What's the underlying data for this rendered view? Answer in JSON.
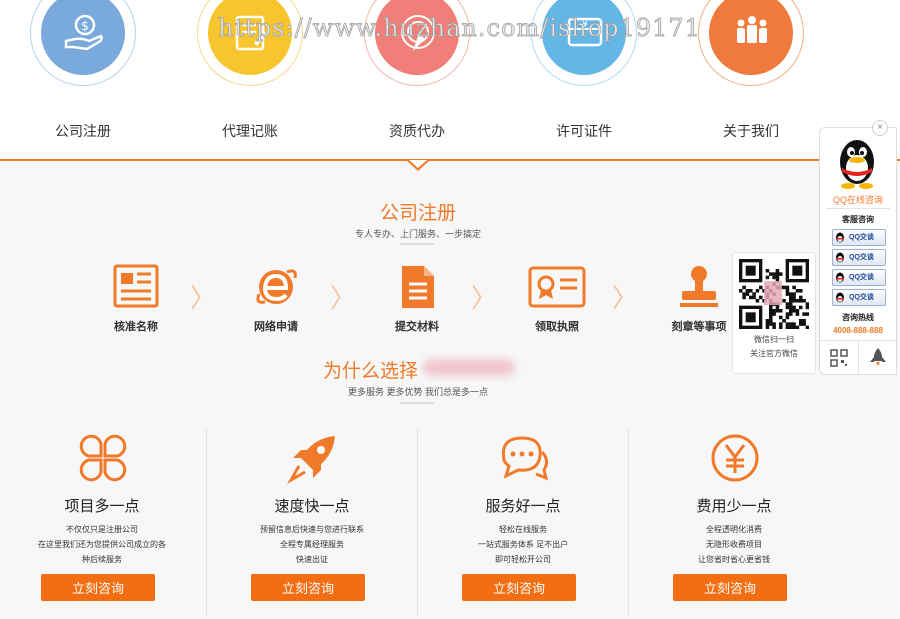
{
  "watermark": "https://www.huzhan.com/ishop19171",
  "nav": {
    "items": [
      {
        "label": "公司注册",
        "icon": "money-hand-icon",
        "color": "#7aa9dc"
      },
      {
        "label": "代理记账",
        "icon": "document-edit-icon",
        "color": "#f7c62e"
      },
      {
        "label": "资质代办",
        "icon": "target-arrow-icon",
        "color": "#ef7f78"
      },
      {
        "label": "许可证件",
        "icon": "certificate-yen-icon",
        "color": "#63b6e6"
      },
      {
        "label": "关于我们",
        "icon": "team-people-icon",
        "color": "#f07a3c"
      }
    ]
  },
  "registration": {
    "title": "公司注册",
    "subtitle": "专人专办、上门服务、一步搞定",
    "steps": [
      "核准名称",
      "网络申请",
      "提交材料",
      "领取执照",
      "刻章等事项"
    ]
  },
  "why": {
    "title": "为什么选择",
    "subtitle": "更多服务 更多优势 我们总是多一点"
  },
  "features": [
    {
      "title": "项目多一点",
      "icon": "clover-icon",
      "lines": [
        "不仅仅只是注册公司",
        "在这里我们还为您提供公司成立的各",
        "种后续服务"
      ],
      "button": "立刻咨询"
    },
    {
      "title": "速度快一点",
      "icon": "rocket-icon",
      "lines": [
        "预留信息后快速与您进行联系",
        "全程专属经理服务",
        "快速出证"
      ],
      "button": "立刻咨询"
    },
    {
      "title": "服务好一点",
      "icon": "chat-bubbles-icon",
      "lines": [
        "轻松在线服务",
        "一站式服务体系 足不出户",
        "即可轻松开公司"
      ],
      "button": "立刻咨询"
    },
    {
      "title": "费用少一点",
      "icon": "yen-coin-icon",
      "lines": [
        "全程透明化消费",
        "无隐形收费项目",
        "让您省时省心更省钱"
      ],
      "button": "立刻咨询"
    }
  ],
  "qr": {
    "line1": "微信扫一扫",
    "line2": "关注官方微信"
  },
  "side": {
    "close": "×",
    "qq_online": "QQ在线咨询",
    "service_title": "客服咨询",
    "qq_buttons": [
      "QQ交谈",
      "QQ交谈",
      "QQ交谈",
      "QQ交谈"
    ],
    "hotline_title": "咨询热线",
    "hotline": "4008-888-888"
  },
  "colors": {
    "accent": "#f07a2a",
    "button": "#f36d12"
  }
}
